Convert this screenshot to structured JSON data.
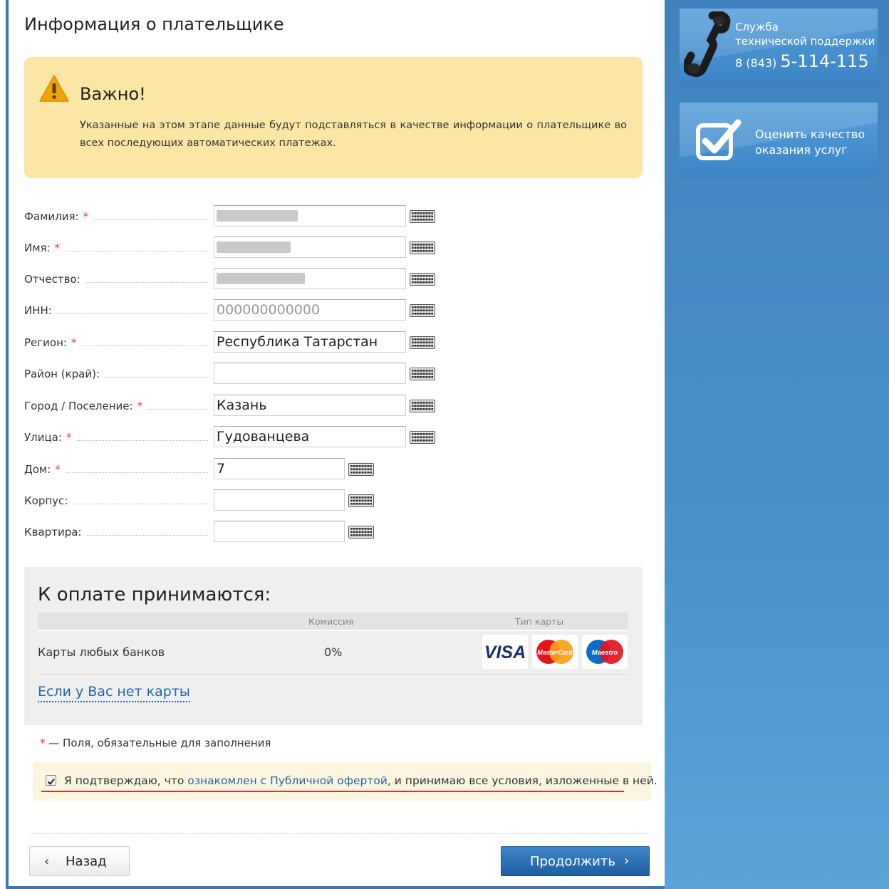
{
  "page": {
    "title": "Информация о плательщике"
  },
  "warning": {
    "title": "Важно!",
    "text": "Указанные на этом этапе данные будут подставляться в качестве информации о плательщике во всех последующих автоматических платежах."
  },
  "form": {
    "required_marker": "*",
    "fields": [
      {
        "label": "Фамилия:",
        "required": true,
        "value": "",
        "blurred": true
      },
      {
        "label": "Имя:",
        "required": true,
        "value": "",
        "blurred": true
      },
      {
        "label": "Отчество:",
        "required": false,
        "value": "",
        "blurred": true
      },
      {
        "label": "ИНН:",
        "required": false,
        "value": "",
        "placeholder": "000000000000"
      },
      {
        "label": "Регион:",
        "required": true,
        "value": "Республика Татарстан"
      },
      {
        "label": "Район (край):",
        "required": false,
        "value": ""
      },
      {
        "label": "Город / Поселение:",
        "required": true,
        "value": "Казань"
      },
      {
        "label": "Улица:",
        "required": true,
        "value": "Гудованцева"
      },
      {
        "label": "Дом:",
        "required": true,
        "value": "7"
      },
      {
        "label": "Корпус:",
        "required": false,
        "value": ""
      },
      {
        "label": "Квартира:",
        "required": false,
        "value": ""
      }
    ]
  },
  "payment": {
    "title": "К оплате принимаются:",
    "columns": {
      "commission": "Комиссия",
      "card_type": "Тип карты"
    },
    "rows": [
      {
        "name": "Карты любых банков",
        "commission": "0%",
        "cards": [
          "VISA",
          "MasterCard",
          "Maestro"
        ]
      }
    ],
    "no_card_link": "Если у Вас нет карты"
  },
  "required_note": {
    "marker": "*",
    "text": "— Поля, обязательные для заполнения"
  },
  "agreement": {
    "checked": true,
    "text_before": "Я подтверждаю, что ",
    "link_text": "ознакомлен с Публичной офертой",
    "text_after": ", и принимаю все условия, изложенные в ней."
  },
  "buttons": {
    "back": "Назад",
    "next": "Продолжить"
  },
  "sidebar": {
    "support": {
      "title_line1": "Служба",
      "title_line2": "технической поддержки",
      "phone_prefix": "8 (843)",
      "phone_number": "5-114-115"
    },
    "rate": {
      "line1": "Оценить качество",
      "line2": "оказания услуг"
    }
  },
  "colors": {
    "warning_bg": "#fbe6a6",
    "link": "#2367a8",
    "required": "#e33333",
    "primary_button": "#2f74b8",
    "sidebar": "#4a8dc8"
  }
}
